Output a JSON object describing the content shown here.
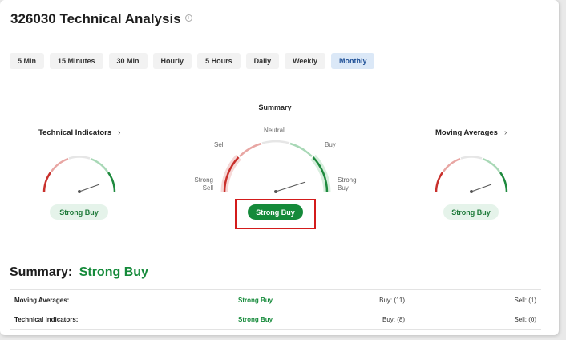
{
  "page_title": "326030 Technical Analysis",
  "timeframes": [
    {
      "label": "5 Min",
      "active": false
    },
    {
      "label": "15 Minutes",
      "active": false
    },
    {
      "label": "30 Min",
      "active": false
    },
    {
      "label": "Hourly",
      "active": false
    },
    {
      "label": "5 Hours",
      "active": false
    },
    {
      "label": "Daily",
      "active": false
    },
    {
      "label": "Weekly",
      "active": false
    },
    {
      "label": "Monthly",
      "active": true
    }
  ],
  "summary_gauge": {
    "heading": "Summary",
    "labels": {
      "strong_sell": "Strong Sell",
      "sell": "Sell",
      "neutral": "Neutral",
      "buy": "Buy",
      "strong_buy": "Strong Buy"
    },
    "signal": "Strong Buy"
  },
  "technical_indicators": {
    "title": "Technical Indicators",
    "signal": "Strong Buy"
  },
  "moving_averages": {
    "title": "Moving Averages",
    "signal": "Strong Buy"
  },
  "summary": {
    "label": "Summary:",
    "value": "Strong Buy"
  },
  "table": [
    {
      "name": "Moving Averages:",
      "signal": "Strong Buy",
      "buy": "Buy: (11)",
      "sell": "Sell: (1)"
    },
    {
      "name": "Technical Indicators:",
      "signal": "Strong Buy",
      "buy": "Buy: (8)",
      "sell": "Sell: (0)"
    }
  ],
  "colors": {
    "strong_sell": "#c9302c",
    "sell": "#e8a6a3",
    "neutral": "#e6e6e6",
    "buy": "#a8d8b6",
    "strong_buy": "#1e8a3e",
    "accent": "#158a3a"
  }
}
